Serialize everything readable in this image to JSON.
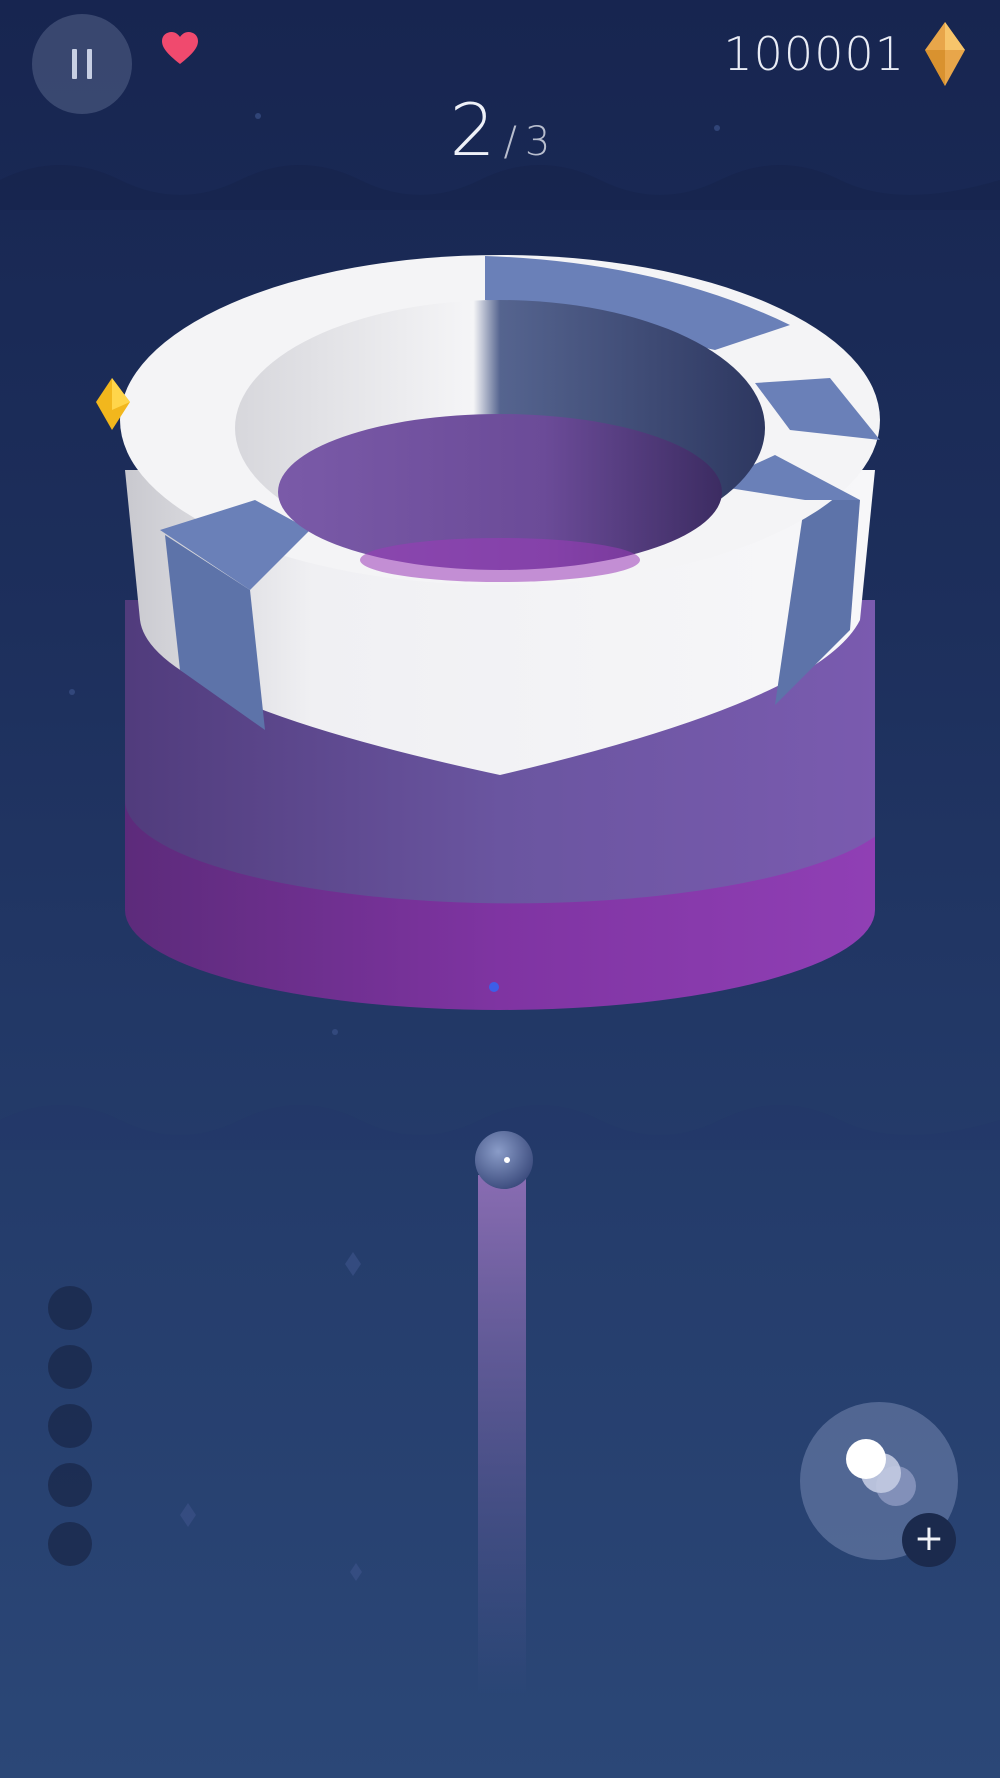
{
  "hud": {
    "coins": "100001",
    "level_current": "2",
    "level_separator": "/",
    "level_total": "3"
  },
  "icons": {
    "pause": "pause-icon",
    "life": "heart-icon",
    "currency": "diamond-gem-icon",
    "ball_skin": "balls-icon",
    "add": "plus-icon"
  },
  "colors": {
    "heart": "#f04a6e",
    "gem": "#e8a64a",
    "tower_white": "#f4f4f6",
    "tower_blue": "#6a80b8",
    "tower_purple": "#7b59a8",
    "tower_magenta": "#8c3aa8",
    "background_top": "#172550",
    "background_bottom": "#2b4777"
  },
  "remaining_balls_indicator": [
    0,
    0,
    0,
    0,
    0
  ],
  "plus_label": "+"
}
